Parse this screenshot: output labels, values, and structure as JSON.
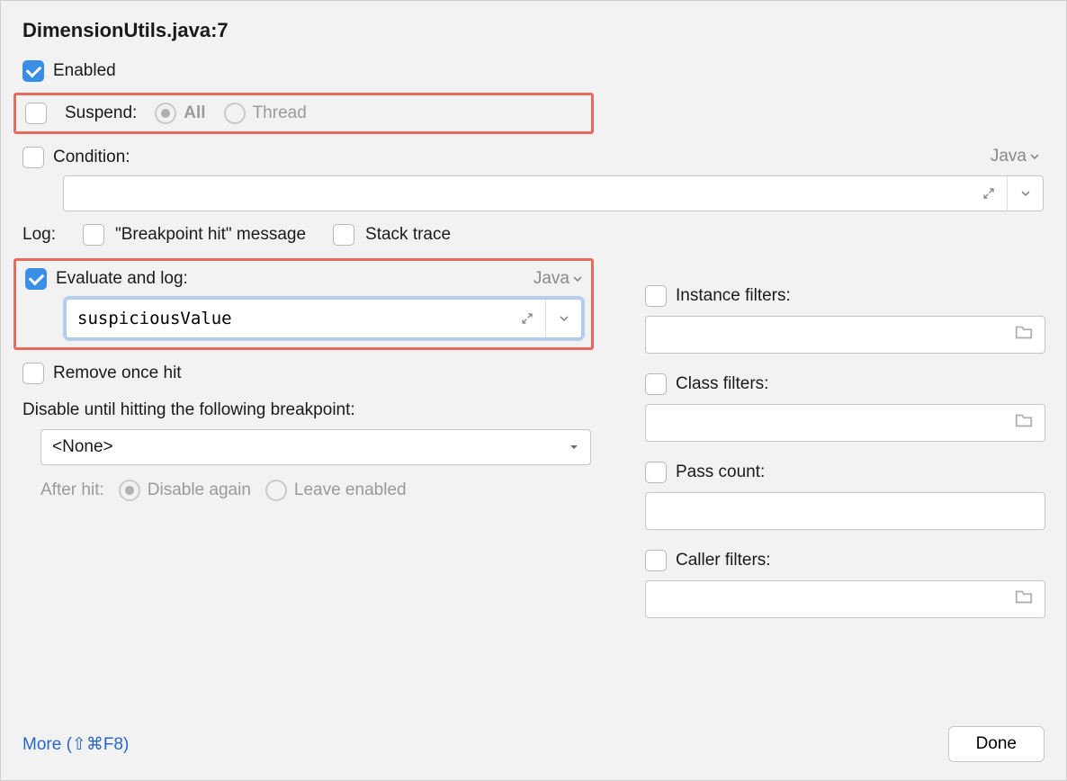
{
  "title": "DimensionUtils.java:7",
  "enabled": {
    "label": "Enabled",
    "checked": true
  },
  "suspend": {
    "label": "Suspend:",
    "checked": false,
    "options": {
      "all": "All",
      "thread": "Thread"
    },
    "selected": "all"
  },
  "condition": {
    "label": "Condition:",
    "checked": false,
    "language": "Java",
    "value": ""
  },
  "log": {
    "label": "Log:",
    "bpHit": {
      "label": "\"Breakpoint hit\" message",
      "checked": false
    },
    "stack": {
      "label": "Stack trace",
      "checked": false
    }
  },
  "evaluate": {
    "label": "Evaluate and log:",
    "checked": true,
    "language": "Java",
    "value": "suspiciousValue"
  },
  "removeOnceHit": {
    "label": "Remove once hit",
    "checked": false
  },
  "disableUntil": {
    "label": "Disable until hitting the following breakpoint:",
    "value": "<None>"
  },
  "afterHit": {
    "label": "After hit:",
    "disable": "Disable again",
    "leave": "Leave enabled",
    "selected": "disable"
  },
  "filters": {
    "instance": {
      "label": "Instance filters:",
      "checked": false,
      "value": ""
    },
    "class": {
      "label": "Class filters:",
      "checked": false,
      "value": ""
    },
    "pass": {
      "label": "Pass count:",
      "checked": false,
      "value": ""
    },
    "caller": {
      "label": "Caller filters:",
      "checked": false,
      "value": ""
    }
  },
  "footer": {
    "more": "More (⇧⌘F8)",
    "done": "Done"
  }
}
